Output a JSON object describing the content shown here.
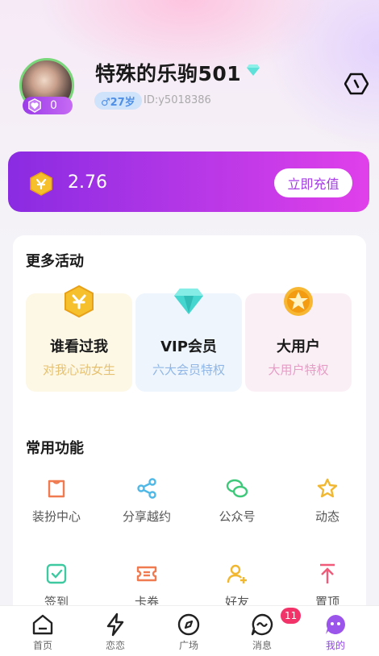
{
  "profile": {
    "nickname": "特殊的乐驹501",
    "badge_count": "0",
    "age_label": "♂27岁",
    "user_id": "ID:y5018386"
  },
  "balance": {
    "amount": "2.76",
    "recharge_label": "立即充值"
  },
  "activities": {
    "title": "更多活动",
    "cards": [
      {
        "title": "谁看过我",
        "subtitle": "对我心动女生",
        "icon": "coin-icon",
        "bg": "#fdf7e6",
        "sub_color": "#e6c270"
      },
      {
        "title": "VIP会员",
        "subtitle": "六大会员特权",
        "icon": "diamond-icon",
        "bg": "#eef5fd",
        "sub_color": "#8fb6e6"
      },
      {
        "title": "大用户",
        "subtitle": "大用户特权",
        "icon": "star-badge-icon",
        "bg": "#fbeff6",
        "sub_color": "#e69cc5"
      }
    ]
  },
  "functions": {
    "title": "常用功能",
    "items": [
      {
        "label": "装扮中心",
        "icon": "shirt-icon",
        "color": "#f07b50"
      },
      {
        "label": "分享越约",
        "icon": "share-icon",
        "color": "#4fb8e6"
      },
      {
        "label": "公众号",
        "icon": "chat-bubbles-icon",
        "color": "#3ec97a"
      },
      {
        "label": "动态",
        "icon": "star-icon",
        "color": "#f2b730"
      },
      {
        "label": "签到",
        "icon": "check-icon",
        "color": "#3ec9a0"
      },
      {
        "label": "卡券",
        "icon": "ticket-icon",
        "color": "#f07b50"
      },
      {
        "label": "好友",
        "icon": "add-user-icon",
        "color": "#f2b730"
      },
      {
        "label": "置顶",
        "icon": "arrow-up-icon",
        "color": "#f25a7a"
      }
    ]
  },
  "nav": {
    "items": [
      {
        "label": "首页",
        "icon": "home-icon"
      },
      {
        "label": "恋恋",
        "icon": "lightning-icon"
      },
      {
        "label": "广场",
        "icon": "compass-icon"
      },
      {
        "label": "消息",
        "icon": "message-icon"
      },
      {
        "label": "我的",
        "icon": "profile-face-icon"
      }
    ],
    "message_badge": "11",
    "active": "我的"
  },
  "colors": {
    "accent_purple": "#a53be6",
    "badge_red": "#f2336a"
  }
}
